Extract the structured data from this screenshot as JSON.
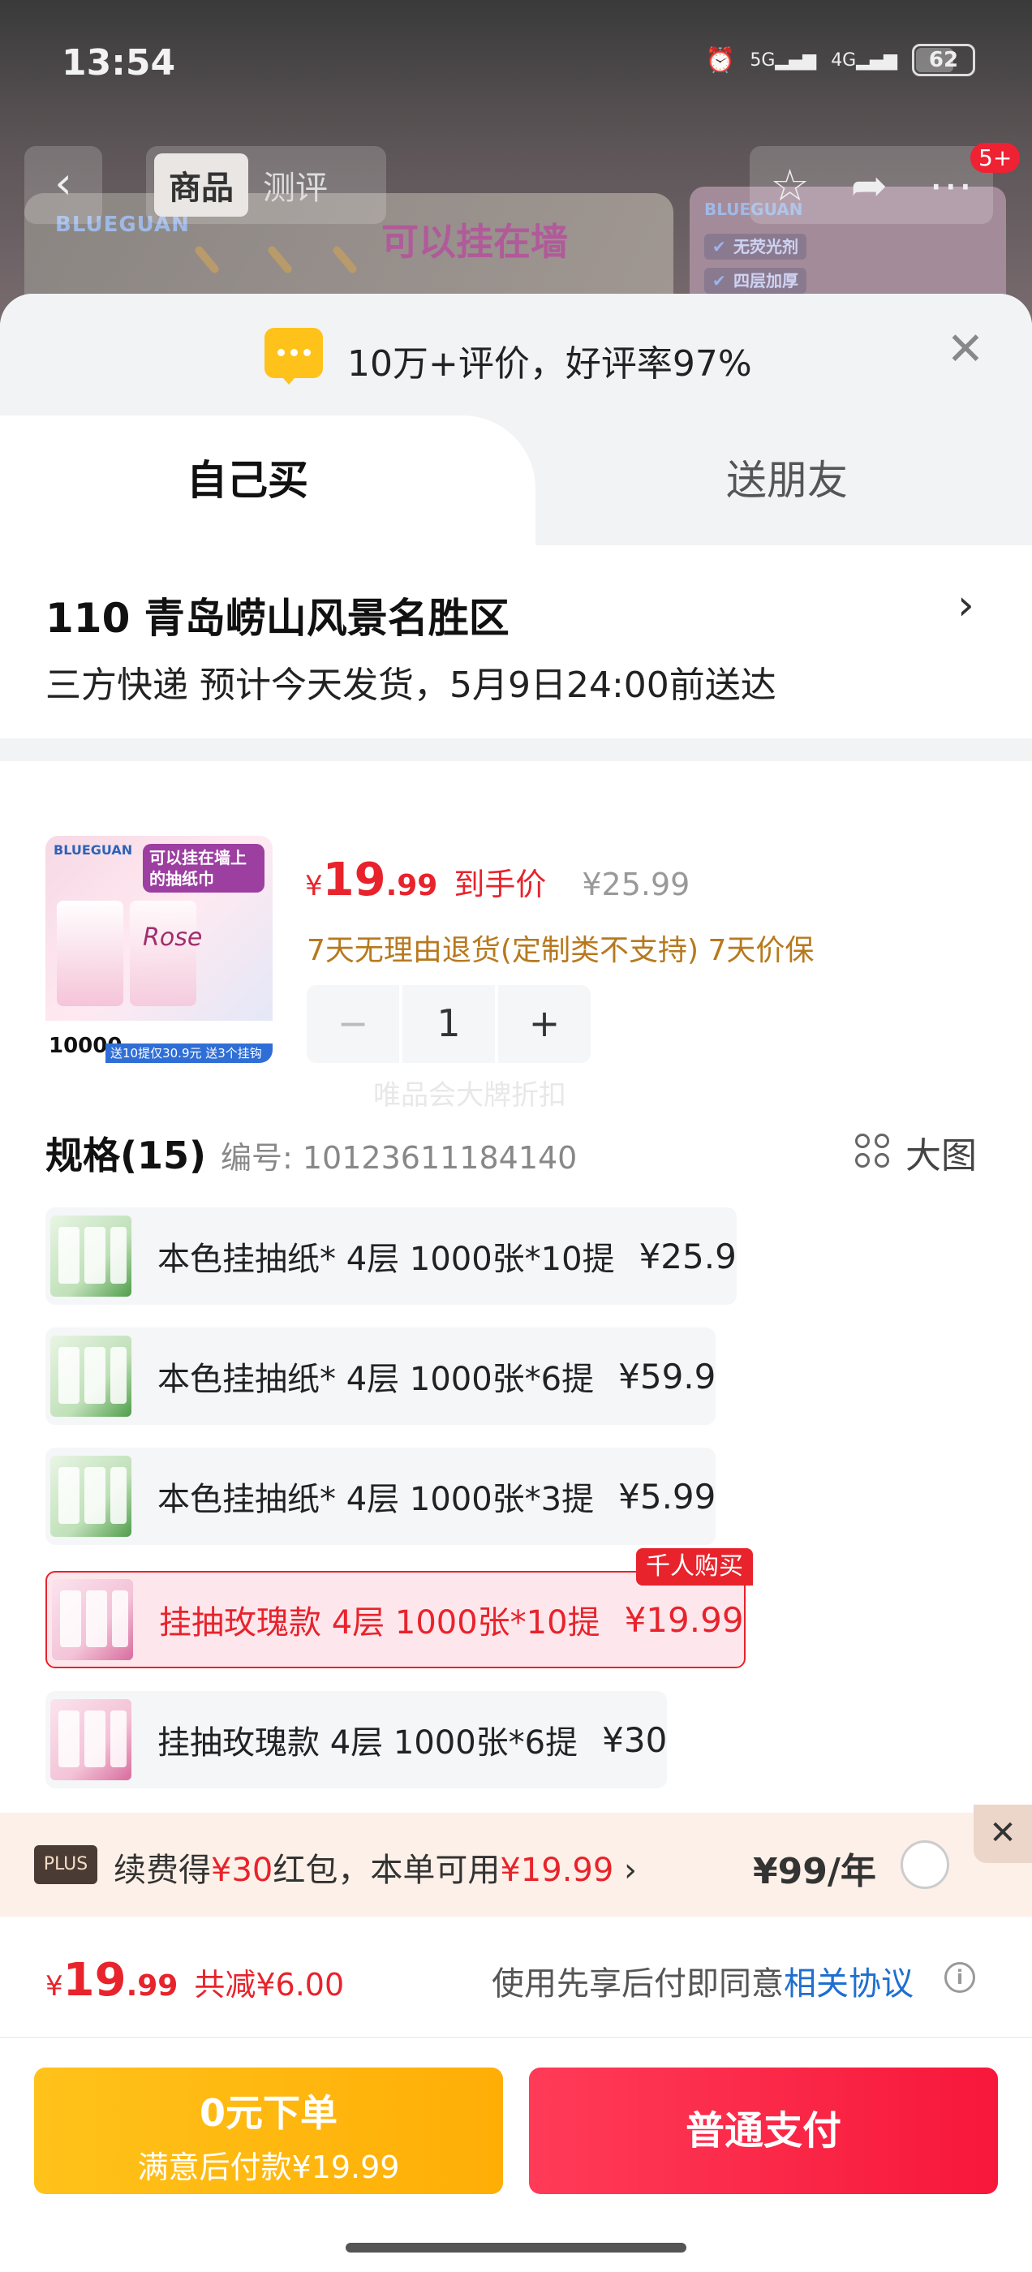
{
  "status_bar": {
    "time": "13:54",
    "network1": "5G",
    "network2": "4G",
    "battery": "62"
  },
  "nav": {
    "tabs": [
      "商品",
      "测评"
    ],
    "badge": "5+"
  },
  "background": {
    "brand": "BLUEGUAN",
    "headline": "可以挂在墙",
    "tags": [
      "无荧光剂",
      "四层加厚"
    ]
  },
  "rating": {
    "text": "10万+评价，好评率97%"
  },
  "purchase_tabs": {
    "own": "自己买",
    "gift": "送朋友"
  },
  "address": {
    "title": "110  青岛崂山风景名胜区",
    "delivery": "三方快递 预计今天发货，5月9日24:00前送达"
  },
  "product": {
    "currency": "¥",
    "price_int": "19",
    "price_dec": ".99",
    "price_label": "到手价",
    "original_price": "¥25.99",
    "policy": "7天无理由退货(定制类不支持) 7天价保",
    "quantity": "1",
    "image": {
      "brand": "BLUEGUAN",
      "headline": "可以挂在墙上的抽纸巾",
      "rose": "Rose",
      "count": "10000",
      "promo": "送10提仅30.9元 送3个挂钩"
    }
  },
  "watermark": "唯品会大牌折扣",
  "spec": {
    "title": "规格(15)",
    "code": "编号: 10123611184140",
    "big_pic": "大图",
    "hot_badge": "千人购买",
    "items": [
      {
        "name": "本色挂抽纸* 4层 1000张*10提",
        "price": "¥25.9",
        "thumb": "green"
      },
      {
        "name": "本色挂抽纸* 4层 1000张*6提",
        "price": "¥59.9",
        "thumb": "green"
      },
      {
        "name": "本色挂抽纸* 4层 1000张*3提",
        "price": "¥5.99",
        "thumb": "green"
      },
      {
        "name": "挂抽玫瑰款 4层 1000张*10提",
        "price": "¥19.99",
        "thumb": "pink",
        "selected": true
      },
      {
        "name": "挂抽玫瑰款 4层 1000张*6提",
        "price": "¥30",
        "thumb": "pink"
      }
    ]
  },
  "plus": {
    "badge": "PLUS",
    "text_pre": "续费得",
    "text_amount": "¥30",
    "text_mid": "红包，本单可用",
    "text_usable": "¥19.99",
    "text_arrow": "›",
    "price": "¥99/年"
  },
  "total": {
    "currency": "¥",
    "int": "19",
    "dec": ".99",
    "save": "共减¥6.00",
    "agree_pre": "使用先享后付即同意",
    "agree_link": "相关协议"
  },
  "buttons": {
    "zero_line1": "0元下单",
    "zero_line2": "满意后付款¥19.99",
    "pay": "普通支付"
  },
  "colors": {
    "accent_red": "#e8232c",
    "yellow": "#ffc21a",
    "pay_red": "#f7173a",
    "link_blue": "#1f6fd0"
  }
}
